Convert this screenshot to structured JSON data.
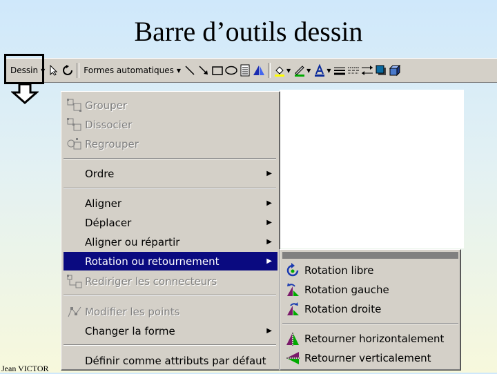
{
  "slide": {
    "title": "Barre d’outils dessin",
    "footer": "Jean VICTOR"
  },
  "toolbar": {
    "draw_menu_label": "Dessin",
    "autoshapes_label": "Formes automatiques"
  },
  "menu": {
    "items": [
      {
        "label": "Grouper",
        "enabled": false,
        "icon": "group-icon"
      },
      {
        "label": "Dissocier",
        "enabled": false,
        "icon": "ungroup-icon"
      },
      {
        "label": "Regrouper",
        "enabled": false,
        "icon": "regroup-icon"
      },
      {
        "label": "Ordre",
        "enabled": true,
        "submenu": true
      },
      {
        "label": "Aligner",
        "enabled": true,
        "submenu": true
      },
      {
        "label": "Déplacer",
        "enabled": true,
        "submenu": true
      },
      {
        "label": "Aligner ou répartir",
        "enabled": true,
        "submenu": true
      },
      {
        "label": "Rotation ou retournement",
        "enabled": true,
        "submenu": true,
        "highlighted": true
      },
      {
        "label": "Rediriger les connecteurs",
        "enabled": false,
        "icon": "reroute-connectors-icon"
      },
      {
        "label": "Modifier les points",
        "enabled": false,
        "icon": "edit-points-icon"
      },
      {
        "label": "Changer la forme",
        "enabled": true,
        "submenu": true
      },
      {
        "label": "Définir comme attributs par défaut",
        "enabled": true
      }
    ]
  },
  "submenu": {
    "items": [
      {
        "label": "Rotation libre",
        "icon": "free-rotate-icon"
      },
      {
        "label": "Rotation gauche",
        "icon": "rotate-left-icon"
      },
      {
        "label": "Rotation droite",
        "icon": "rotate-right-icon"
      },
      {
        "label": "Retourner horizontalement",
        "icon": "flip-horizontal-icon"
      },
      {
        "label": "Retourner verticalement",
        "icon": "flip-vertical-icon"
      }
    ]
  },
  "colors": {
    "highlight": "#0a0a80",
    "menu_bg": "#d4d0c8",
    "disabled_text": "#808080"
  }
}
